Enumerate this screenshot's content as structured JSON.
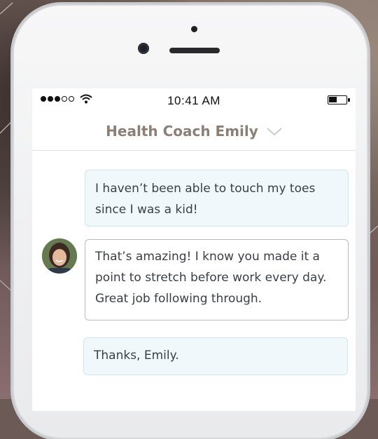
{
  "status_bar": {
    "time": "10:41 AM",
    "signal_bars_filled": 3,
    "signal_bars_total": 5,
    "battery_level": 0.45
  },
  "chat_header": {
    "title": "Health Coach Emily",
    "dropdown_icon": "chevron-down-icon"
  },
  "messages": [
    {
      "sender": "user",
      "text": "I haven’t been able to touch my toes since I was a kid!"
    },
    {
      "sender": "coach",
      "text": "That’s amazing! I know you made it a point to stretch before work every day. Great job following through."
    },
    {
      "sender": "user",
      "text": "Thanks, Emily."
    }
  ],
  "colors": {
    "header_text": "#8c7f76",
    "user_bubble_bg": "#f1f8fc",
    "user_bubble_border": "#cde6f2",
    "coach_bubble_border": "#b9bcbf",
    "message_text": "#3a3f44"
  }
}
